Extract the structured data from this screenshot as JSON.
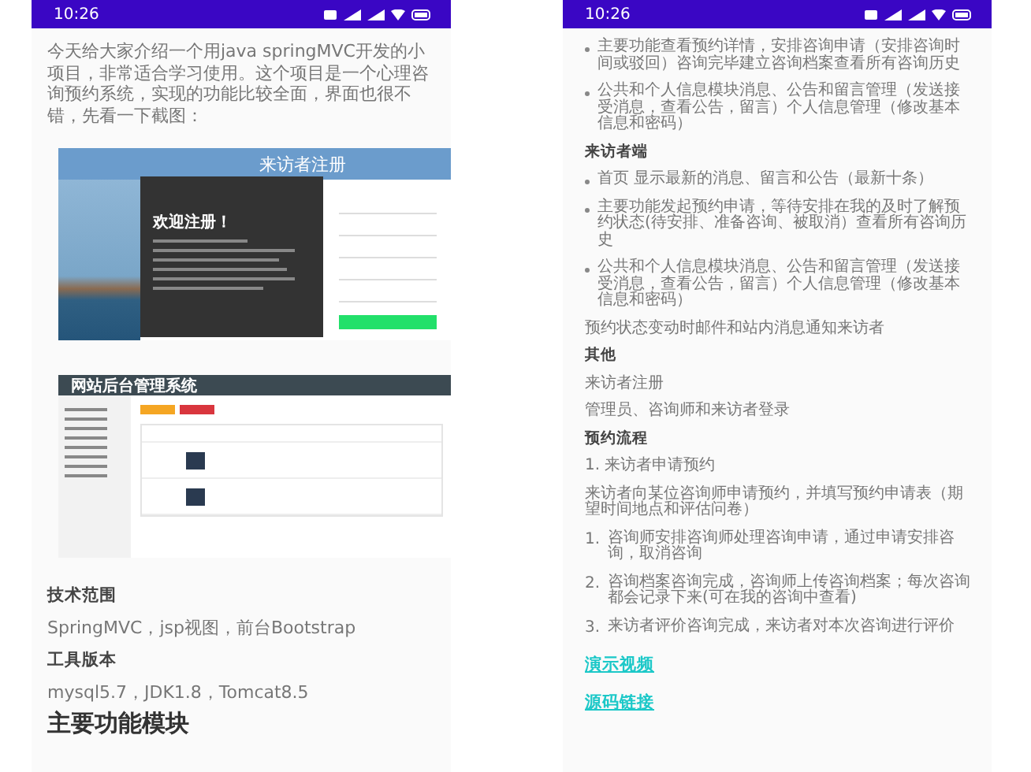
{
  "phones": [
    {
      "status_bar": {
        "time": "10:26"
      },
      "content": [
        {
          "kind": "paragraph",
          "text": "今天给大家介绍一个用java springMVC开发的小项目，非常适合学习使用。这个项目是一个心理咨询预约系统，实现的功能比较全面，界面也很不错，先看一下截图："
        },
        {
          "kind": "register_screenshot",
          "banner": "来访者注册",
          "welcome": "欢迎注册！"
        },
        {
          "kind": "admin_screenshot",
          "title": "网站后台管理系统"
        },
        {
          "kind": "heading",
          "text": "技术范围"
        },
        {
          "kind": "paragraph",
          "text": "SpringMVC，jsp视图，前台Bootstrap"
        },
        {
          "kind": "heading",
          "text": "工具版本"
        },
        {
          "kind": "paragraph",
          "text": "mysql5.7，JDK1.8，Tomcat8.5"
        },
        {
          "kind": "title",
          "text": "主要功能模块"
        }
      ]
    },
    {
      "status_bar": {
        "time": "10:26"
      },
      "content": [
        {
          "kind": "bullet",
          "text": "主要功能查看预约详情，安排咨询申请（安排咨询时间或驳回）咨询完毕建立咨询档案查看所有咨询历史"
        },
        {
          "kind": "bullet",
          "text": "公共和个人信息模块消息、公告和留言管理（发送接受消息，查看公告，留言）个人信息管理（修改基本信息和密码）"
        },
        {
          "kind": "heading",
          "text": "来访者端"
        },
        {
          "kind": "bullet",
          "text": "首页 显示最新的消息、留言和公告（最新十条）"
        },
        {
          "kind": "bullet",
          "text": "主要功能发起预约申请，等待安排在我的及时了解预约状态(待安排、准备咨询、被取消）查看所有咨询历史"
        },
        {
          "kind": "bullet",
          "text": "公共和个人信息模块消息、公告和留言管理（发送接受消息，查看公告，留言）个人信息管理（修改基本信息和密码）"
        },
        {
          "kind": "paragraph",
          "text": "预约状态变动时邮件和站内消息通知来访者"
        },
        {
          "kind": "heading",
          "text": "其他"
        },
        {
          "kind": "paragraph",
          "text": "来访者注册"
        },
        {
          "kind": "paragraph",
          "text": "管理员、咨询师和来访者登录"
        },
        {
          "kind": "heading",
          "text": "预约流程"
        },
        {
          "kind": "paragraph",
          "text": "1. 来访者申请预约"
        },
        {
          "kind": "paragraph",
          "text": "来访者向某位咨询师申请预约，并填写预约申请表（期望时间地点和评估问卷）"
        },
        {
          "kind": "numbered",
          "number": "1.",
          "text": "咨询师安排咨询师处理咨询申请，通过申请安排咨询，取消咨询"
        },
        {
          "kind": "numbered",
          "number": "2.",
          "text": "咨询档案咨询完成，咨询师上传咨询档案；每次咨询都会记录下来(可在我的咨询中查看)"
        },
        {
          "kind": "numbered",
          "number": "3.",
          "text": "来访者评价咨询完成，来访者对本次咨询进行评价"
        },
        {
          "kind": "link",
          "text": "演示视频"
        },
        {
          "kind": "link",
          "text": "源码链接"
        }
      ]
    }
  ]
}
